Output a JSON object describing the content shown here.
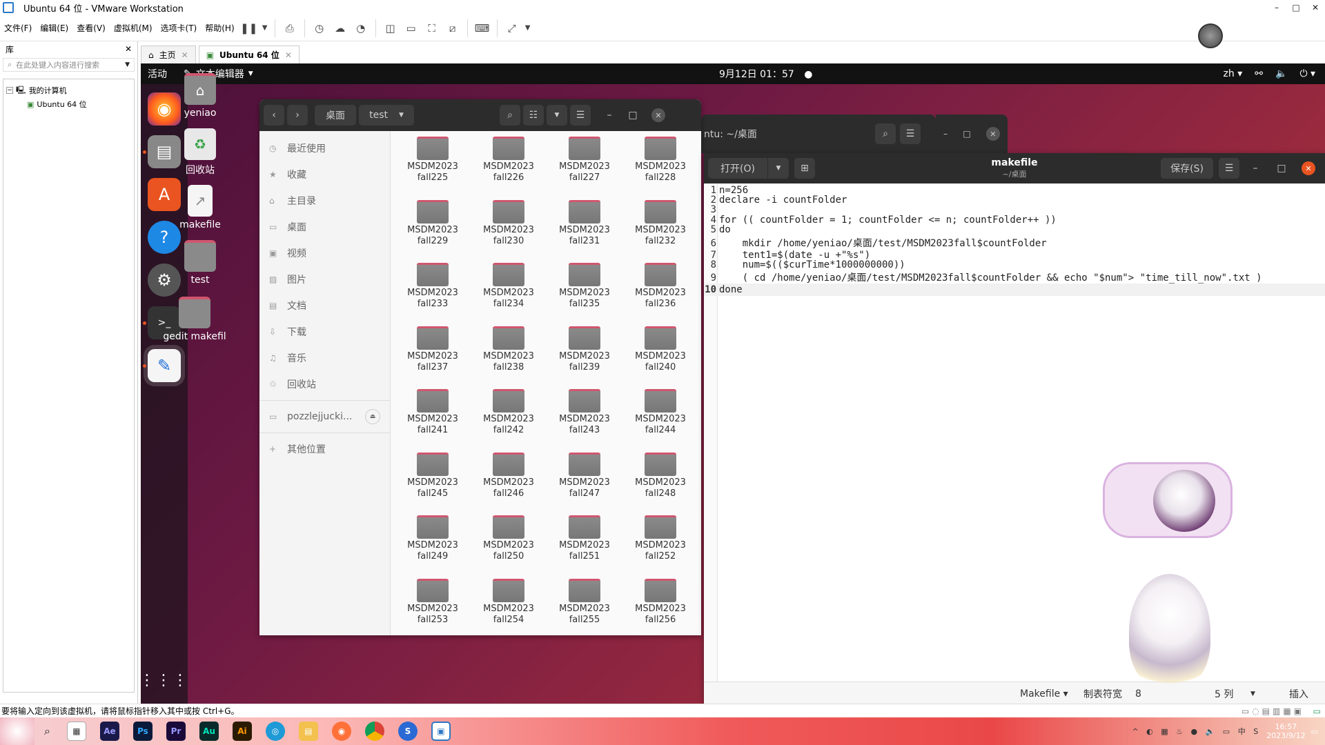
{
  "window": {
    "title": "Ubuntu 64 位 - VMware Workstation"
  },
  "menu": {
    "items": [
      "文件(F)",
      "编辑(E)",
      "查看(V)",
      "虚拟机(M)",
      "选项卡(T)",
      "帮助(H)"
    ]
  },
  "library": {
    "title": "库",
    "search_placeholder": "在此处键入内容进行搜索",
    "tree": {
      "root": "我的计算机",
      "child": "Ubuntu 64 位"
    }
  },
  "tabs": [
    {
      "label": "主页"
    },
    {
      "label": "Ubuntu 64 位"
    }
  ],
  "ubuntu": {
    "topbar": {
      "activities": "活动",
      "app_menu": "文本编辑器",
      "clock": "9月12日 01：57",
      "lang": "zh"
    },
    "desktop_icons": [
      {
        "label": "yeniao"
      },
      {
        "label": "回收站"
      },
      {
        "label": "makefile"
      },
      {
        "label": "test"
      },
      {
        "label": "gedit makefil"
      }
    ]
  },
  "files": {
    "path": [
      "桌面",
      "test"
    ],
    "sidebar": [
      {
        "label": "最近使用",
        "icon": "clock-icon"
      },
      {
        "label": "收藏",
        "icon": "star-icon"
      },
      {
        "label": "主目录",
        "icon": "home-icon"
      },
      {
        "label": "桌面",
        "icon": "desktop-icon"
      },
      {
        "label": "视频",
        "icon": "video-icon"
      },
      {
        "label": "图片",
        "icon": "image-icon"
      },
      {
        "label": "文档",
        "icon": "document-icon"
      },
      {
        "label": "下载",
        "icon": "download-icon"
      },
      {
        "label": "音乐",
        "icon": "music-icon"
      },
      {
        "label": "回收站",
        "icon": "trash-icon"
      }
    ],
    "device": "pozzlejjucki...",
    "other": "其他位置",
    "folders": [
      [
        "MSDM2023",
        "fall225"
      ],
      [
        "MSDM2023",
        "fall226"
      ],
      [
        "MSDM2023",
        "fall227"
      ],
      [
        "MSDM2023",
        "fall228"
      ],
      [
        "MSDM2023",
        "fall229"
      ],
      [
        "MSDM2023",
        "fall230"
      ],
      [
        "MSDM2023",
        "fall231"
      ],
      [
        "MSDM2023",
        "fall232"
      ],
      [
        "MSDM2023",
        "fall233"
      ],
      [
        "MSDM2023",
        "fall234"
      ],
      [
        "MSDM2023",
        "fall235"
      ],
      [
        "MSDM2023",
        "fall236"
      ],
      [
        "MSDM2023",
        "fall237"
      ],
      [
        "MSDM2023",
        "fall238"
      ],
      [
        "MSDM2023",
        "fall239"
      ],
      [
        "MSDM2023",
        "fall240"
      ],
      [
        "MSDM2023",
        "fall241"
      ],
      [
        "MSDM2023",
        "fall242"
      ],
      [
        "MSDM2023",
        "fall243"
      ],
      [
        "MSDM2023",
        "fall244"
      ],
      [
        "MSDM2023",
        "fall245"
      ],
      [
        "MSDM2023",
        "fall246"
      ],
      [
        "MSDM2023",
        "fall247"
      ],
      [
        "MSDM2023",
        "fall248"
      ],
      [
        "MSDM2023",
        "fall249"
      ],
      [
        "MSDM2023",
        "fall250"
      ],
      [
        "MSDM2023",
        "fall251"
      ],
      [
        "MSDM2023",
        "fall252"
      ],
      [
        "MSDM2023",
        "fall253"
      ],
      [
        "MSDM2023",
        "fall254"
      ],
      [
        "MSDM2023",
        "fall255"
      ],
      [
        "MSDM2023",
        "fall256"
      ]
    ]
  },
  "terminal": {
    "title": "ntu: ~/桌面"
  },
  "gedit": {
    "open_label": "打开(O)",
    "save_label": "保存(S)",
    "title": "makefile",
    "subtitle": "~/桌面",
    "lines": [
      "n=256",
      "declare -i countFolder",
      "",
      "for (( countFolder = 1; countFolder <= n; countFolder++ ))",
      "do",
      "    mkdir /home/yeniao/桌面/test/MSDM2023fall$countFolder",
      "    tent1=$(date -u +\"%s\")",
      "    num=$(($curTime*1000000000))",
      "    ( cd /home/yeniao/桌面/test/MSDM2023fall$countFolder && echo \"$num\"> \"time_till_now\".txt )",
      "done"
    ],
    "status": {
      "language": "Makefile",
      "tab_label": "制表符宽",
      "tab_width": "8",
      "column": "5 列",
      "mode": "插入"
    }
  },
  "vm_status": "要将输入定向到该虚拟机，请将鼠标指针移入其中或按 Ctrl+G。",
  "taskbar": {
    "apps": [
      "Ae",
      "Ps",
      "Pr",
      "Au",
      "Ai"
    ],
    "time": "16:57",
    "date": "2023/9/12"
  },
  "colors": {
    "ubuntu_orange": "#e95420",
    "folder_accent": "#d0566e",
    "headerbar": "#2c2c2c"
  }
}
